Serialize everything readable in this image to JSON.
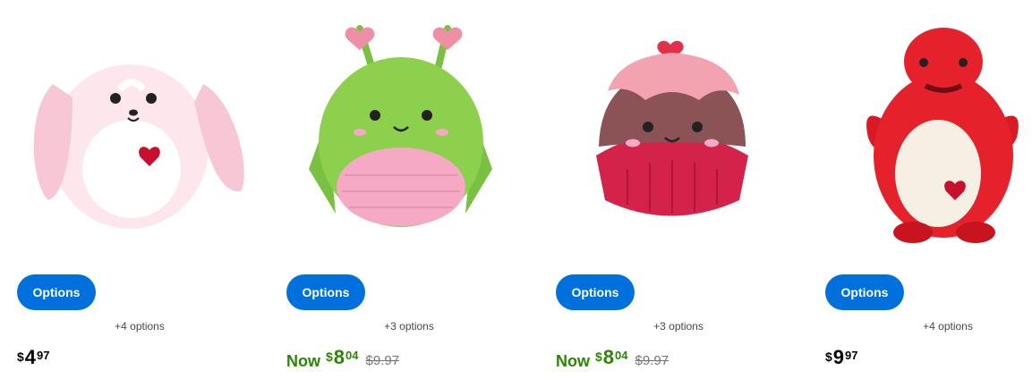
{
  "products": [
    {
      "image_alt": "pink bunny plush",
      "button": "Options",
      "more_options": "+4 options",
      "price": {
        "symbol": "$",
        "dollars": "4",
        "cents": "97"
      }
    },
    {
      "image_alt": "green bug plush",
      "button": "Options",
      "more_options": "+3 options",
      "price": {
        "now_label": "Now",
        "symbol": "$",
        "dollars": "8",
        "cents": "04",
        "was": "$9.97"
      }
    },
    {
      "image_alt": "cupcake plush",
      "button": "Options",
      "more_options": "+3 options",
      "price": {
        "now_label": "Now",
        "symbol": "$",
        "dollars": "8",
        "cents": "04",
        "was": "$9.97"
      }
    },
    {
      "image_alt": "red dinosaur plush",
      "button": "Options",
      "more_options": "+4 options",
      "price": {
        "symbol": "$",
        "dollars": "9",
        "cents": "97"
      }
    }
  ],
  "colors": {
    "accent": "#0071dc",
    "now_price": "#2a8703",
    "was_price": "#74767c"
  }
}
